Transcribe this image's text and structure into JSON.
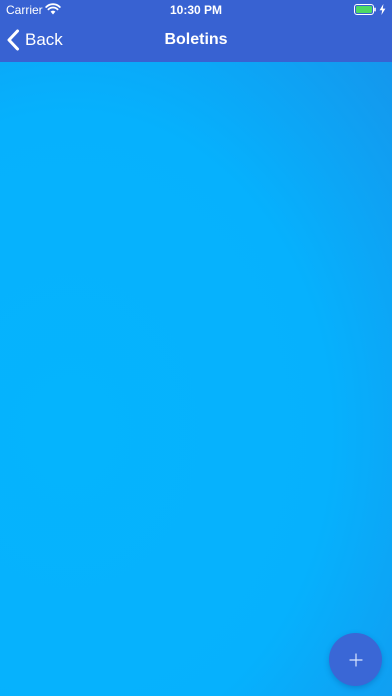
{
  "status_bar": {
    "carrier": "Carrier",
    "time": "10:30 PM",
    "battery_color": "#4cd964"
  },
  "nav": {
    "back_label": "Back",
    "title": "Boletins"
  },
  "fab": {
    "icon": "plus-icon"
  },
  "colors": {
    "navbar": "#3862d2",
    "background_light": "#05b4fd",
    "background_dark": "#2b72dc",
    "fab": "#3a67d6"
  }
}
